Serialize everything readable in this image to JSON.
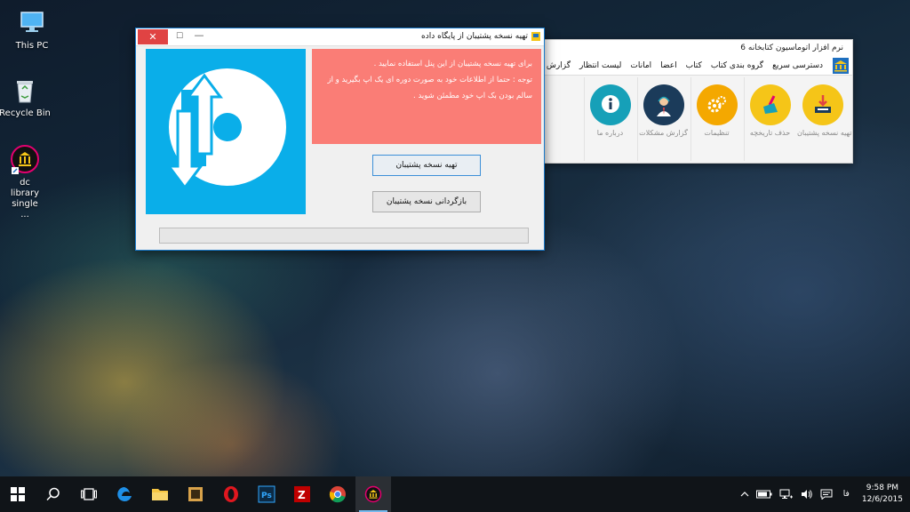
{
  "desktop": {
    "icons": [
      {
        "label": "This PC",
        "icon": "computer-icon"
      },
      {
        "label": "Recycle Bin",
        "icon": "recycle-bin-icon"
      },
      {
        "label": "dc library single ...",
        "icon": "library-app-icon"
      }
    ]
  },
  "main_app": {
    "title": "نرم افزار اتوماسیون کتابخانه 6",
    "menu": [
      "دسترسی سریع",
      "گروه بندی کتاب",
      "کتاب",
      "اعضا",
      "امانات",
      "لیست انتظار",
      "گزارش"
    ],
    "tiles": [
      {
        "label": "تهیه نسخه پشتیبان",
        "icon": "backup-icon",
        "color": "#f5c518"
      },
      {
        "label": "حذف تاریخچه",
        "icon": "broom-icon",
        "color": "#f5c518"
      },
      {
        "label": "تنظیمات",
        "icon": "gears-icon",
        "color": "#f4a800"
      },
      {
        "label": "گزارش مشکلات",
        "icon": "support-agent-icon",
        "color": "#1b3b5a"
      },
      {
        "label": "درباره ما",
        "icon": "info-icon",
        "color": "#16a0b8"
      }
    ]
  },
  "dialog": {
    "title": "تهیه نسخه پشتیبان از پایگاه داده",
    "close": "✕",
    "maximize": "☐",
    "minimize": "—",
    "info_lines": [
      "برای تهیه نسخه پشتیبان از این پنل استفاده نمایید .",
      "توجه : حتما از اطلاعات خود به صورت دوره ای یک اپ بگیرید و از",
      "سالم بودن بک اپ خود مطمئن شوید ."
    ],
    "backup_button": "تهیه نسخه پشتیبان",
    "restore_button": "بازگردانی نسخه پشتیبان",
    "progress": 0,
    "colors": {
      "logo_bg": "#0aaee9",
      "info_bg": "#fa7d76"
    }
  },
  "taskbar": {
    "apps": [
      "start-icon",
      "search-icon",
      "task-view-icon",
      "edge-icon",
      "file-explorer-icon",
      "app-icon",
      "opera-icon",
      "photoshop-icon",
      "filezilla-icon",
      "chrome-icon",
      "library-app-icon"
    ],
    "language": "فا",
    "time": "9:58 PM",
    "date": "12/6/2015"
  }
}
